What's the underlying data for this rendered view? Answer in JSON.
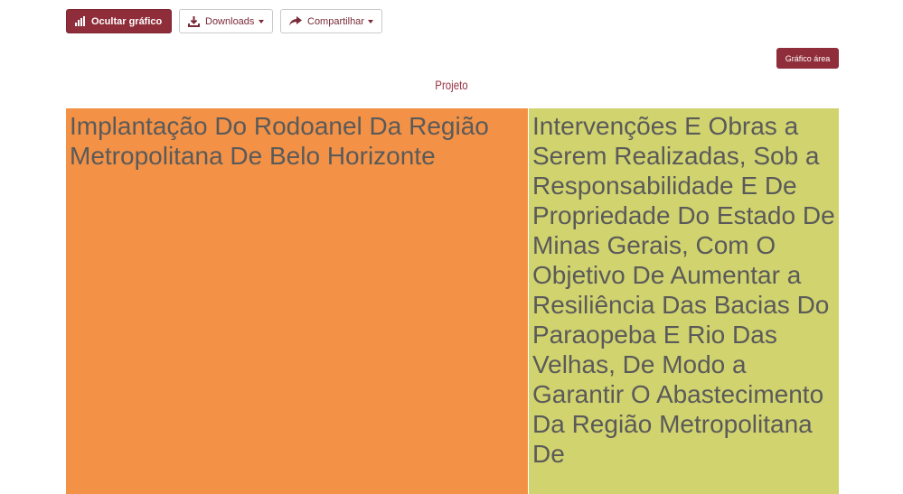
{
  "toolbar": {
    "hide_chart_label": "Ocultar gráfico",
    "downloads_label": "Downloads",
    "share_label": "Compartilhar"
  },
  "area_button_label": "Gráfico área",
  "colors": {
    "accent": "#8f2d3a",
    "cell_1": "#f39246",
    "cell_2": "#d1d36e"
  },
  "chart_data": {
    "type": "treemap",
    "title": "Projeto",
    "items": [
      {
        "label": "Implantação Do Rodoanel Da Região Metropolitana De Belo Horizonte",
        "share": 0.598,
        "color": "#f39246"
      },
      {
        "label": "Intervenções E Obras a Serem Realizadas, Sob a Responsabilidade E De Propriedade Do Estado De Minas Gerais, Com O Objetivo De Aumentar a Resiliência Das Bacias Do Paraopeba E Rio Das Velhas, De Modo a Garantir O Abastecimento Da Região Metropolitana De",
        "share": 0.402,
        "color": "#d1d36e"
      }
    ]
  }
}
